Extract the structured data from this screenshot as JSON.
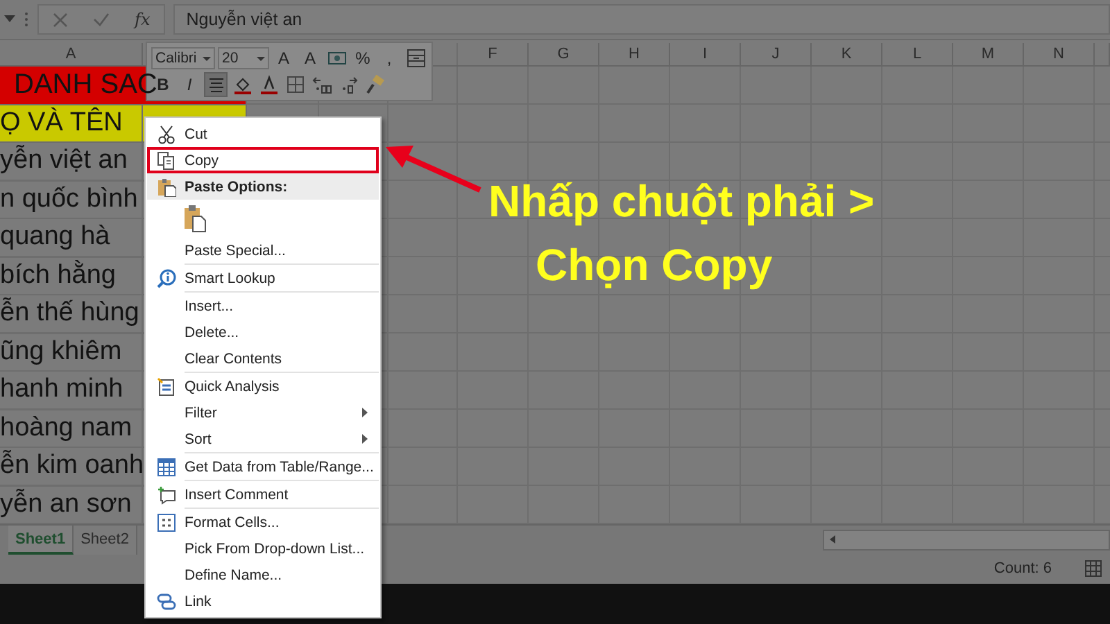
{
  "formula_bar": {
    "function_label": "fx",
    "value": "Nguyễn việt an"
  },
  "columns": [
    "A",
    "F",
    "G",
    "H",
    "I",
    "J",
    "K",
    "L",
    "M",
    "N"
  ],
  "rows": [
    {
      "kind": "title",
      "text": "DANH SAC"
    },
    {
      "kind": "header",
      "text": "Ọ VÀ TÊN"
    },
    {
      "kind": "data",
      "text": "yễn việt an"
    },
    {
      "kind": "data",
      "text": "n quốc bình"
    },
    {
      "kind": "data",
      "text": "quang hà"
    },
    {
      "kind": "data",
      "text": "bích hằng"
    },
    {
      "kind": "data",
      "text": "ễn thế hùng"
    },
    {
      "kind": "data",
      "text": "ũng khiêm"
    },
    {
      "kind": "data",
      "text": "hanh minh"
    },
    {
      "kind": "data",
      "text": "hoàng nam"
    },
    {
      "kind": "data",
      "text": "ễn kim oanh"
    },
    {
      "kind": "data",
      "text": "yễn an sơn"
    }
  ],
  "mini_toolbar": {
    "font_controls": [
      {
        "kind": "dropdown",
        "value": "Calibri"
      },
      {
        "kind": "dropdown",
        "value": "20"
      },
      {
        "kind": "text",
        "label": "A"
      },
      {
        "kind": "text",
        "label": "A"
      },
      {
        "kind": "icon"
      },
      {
        "kind": "text",
        "label": "%"
      },
      {
        "kind": "text",
        "label": ","
      },
      {
        "kind": "icon"
      }
    ],
    "format_buttons": [
      {
        "kind": "text",
        "label": "B",
        "pressed": false
      },
      {
        "kind": "text",
        "label": "I",
        "pressed": false
      },
      {
        "kind": "icon",
        "pressed": true
      },
      {
        "kind": "icon",
        "pressed": false
      },
      {
        "kind": "icon",
        "pressed": false
      },
      {
        "kind": "icon",
        "pressed": false
      },
      {
        "kind": "icon",
        "pressed": false
      },
      {
        "kind": "icon",
        "pressed": false
      },
      {
        "kind": "icon",
        "pressed": false
      }
    ]
  },
  "context_menu": {
    "items": [
      {
        "kind": "item",
        "label": "Cut",
        "selected": false,
        "submenu": false
      },
      {
        "kind": "item",
        "label": "Copy",
        "selected": true,
        "submenu": false
      },
      {
        "kind": "heading",
        "label": "Paste Options:"
      },
      {
        "kind": "paste_buttons"
      },
      {
        "kind": "item",
        "label": "Paste Special...",
        "selected": false,
        "submenu": false
      },
      {
        "kind": "separator"
      },
      {
        "kind": "item",
        "label": "Smart Lookup",
        "selected": false,
        "submenu": false
      },
      {
        "kind": "separator"
      },
      {
        "kind": "item",
        "label": "Insert...",
        "selected": false,
        "submenu": false
      },
      {
        "kind": "item",
        "label": "Delete...",
        "selected": false,
        "submenu": false
      },
      {
        "kind": "item",
        "label": "Clear Contents",
        "selected": false,
        "submenu": false
      },
      {
        "kind": "separator"
      },
      {
        "kind": "item",
        "label": "Quick Analysis",
        "selected": false,
        "submenu": false
      },
      {
        "kind": "item",
        "label": "Filter",
        "selected": false,
        "submenu": true
      },
      {
        "kind": "item",
        "label": "Sort",
        "selected": false,
        "submenu": true
      },
      {
        "kind": "separator"
      },
      {
        "kind": "item",
        "label": "Get Data from Table/Range...",
        "selected": false,
        "submenu": false
      },
      {
        "kind": "separator"
      },
      {
        "kind": "item",
        "label": "Insert Comment",
        "selected": false,
        "submenu": false
      },
      {
        "kind": "separator"
      },
      {
        "kind": "item",
        "label": "Format Cells...",
        "selected": false,
        "submenu": false
      },
      {
        "kind": "item",
        "label": "Pick From Drop-down List...",
        "selected": false,
        "submenu": false
      },
      {
        "kind": "item",
        "label": "Define Name...",
        "selected": false,
        "submenu": false
      },
      {
        "kind": "item",
        "label": "Link",
        "selected": false,
        "submenu": false
      }
    ]
  },
  "sheet_tabs": [
    {
      "label": "Sheet1",
      "selected": true
    },
    {
      "label": "Sheet2",
      "selected": false
    }
  ],
  "status_bar": {
    "count": "Count: 6"
  },
  "annotation": {
    "lines": [
      "Nhấp chuột phải >",
      "Chọn Copy"
    ]
  }
}
